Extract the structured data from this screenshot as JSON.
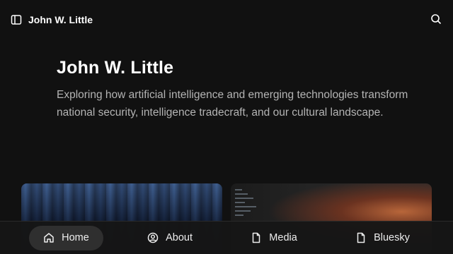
{
  "header": {
    "site_name": "John W. Little",
    "sidebar_icon": "sidebar-toggle-icon",
    "search_icon": "search-icon"
  },
  "hero": {
    "title": "John W. Little",
    "description": "Exploring how artificial intelligence and emerging technologies transform national security, intelligence tradecraft, and our cultural landscape."
  },
  "bottom_nav": {
    "items": [
      {
        "label": "Home",
        "icon": "home-icon",
        "active": true
      },
      {
        "label": "About",
        "icon": "user-circle-icon",
        "active": false
      },
      {
        "label": "Media",
        "icon": "document-icon",
        "active": false
      },
      {
        "label": "Bluesky",
        "icon": "document-icon",
        "active": false
      }
    ]
  },
  "colors": {
    "background": "#111111",
    "text_primary": "#ffffff",
    "text_secondary": "#b4b4b4",
    "nav_active": "#2f2f2f"
  }
}
